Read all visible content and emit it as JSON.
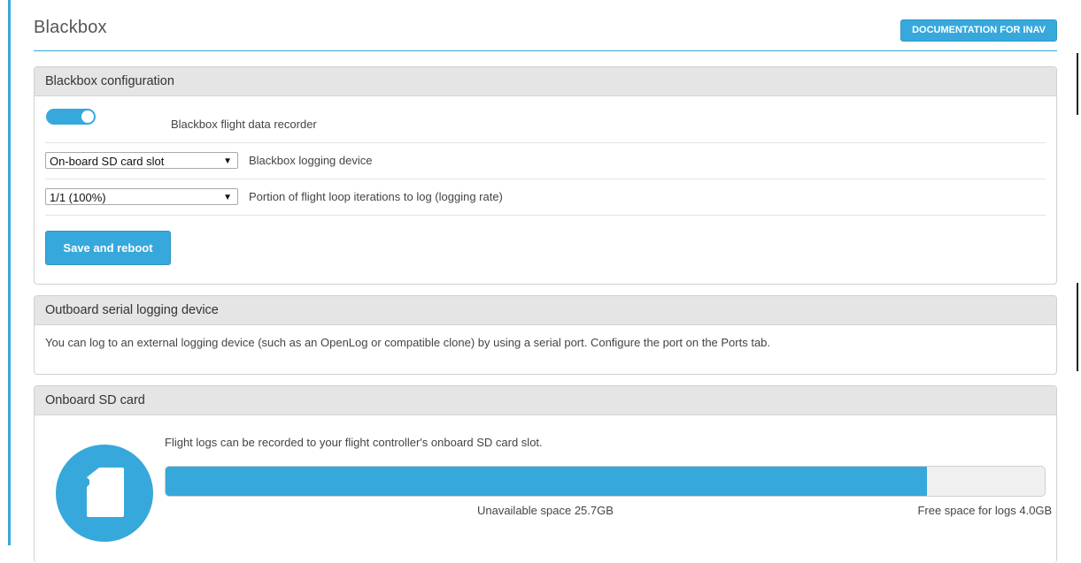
{
  "header": {
    "title": "Blackbox",
    "doc_button": "DOCUMENTATION FOR INAV"
  },
  "config": {
    "heading": "Blackbox configuration",
    "recorder_label": "Blackbox flight data recorder",
    "recorder_enabled": true,
    "device_select_value": "On-board SD card slot",
    "device_label": "Blackbox logging device",
    "rate_select_value": "1/1 (100%)",
    "rate_label": "Portion of flight loop iterations to log (logging rate)",
    "save_button": "Save and reboot"
  },
  "serial": {
    "heading": "Outboard serial logging device",
    "text": "You can log to an external logging device (such as an OpenLog or compatible clone) by using a serial port. Configure the port on the Ports tab."
  },
  "sdcard": {
    "heading": "Onboard SD card",
    "description": "Flight logs can be recorded to your flight controller's onboard SD card slot.",
    "used_fraction": 0.866,
    "unavailable_label": "Unavailable space 25.7GB",
    "free_label": "Free space for logs 4.0GB",
    "icon": "sd-card-icon"
  },
  "colors": {
    "accent": "#37a8db",
    "header_bg": "#e5e5e5"
  }
}
